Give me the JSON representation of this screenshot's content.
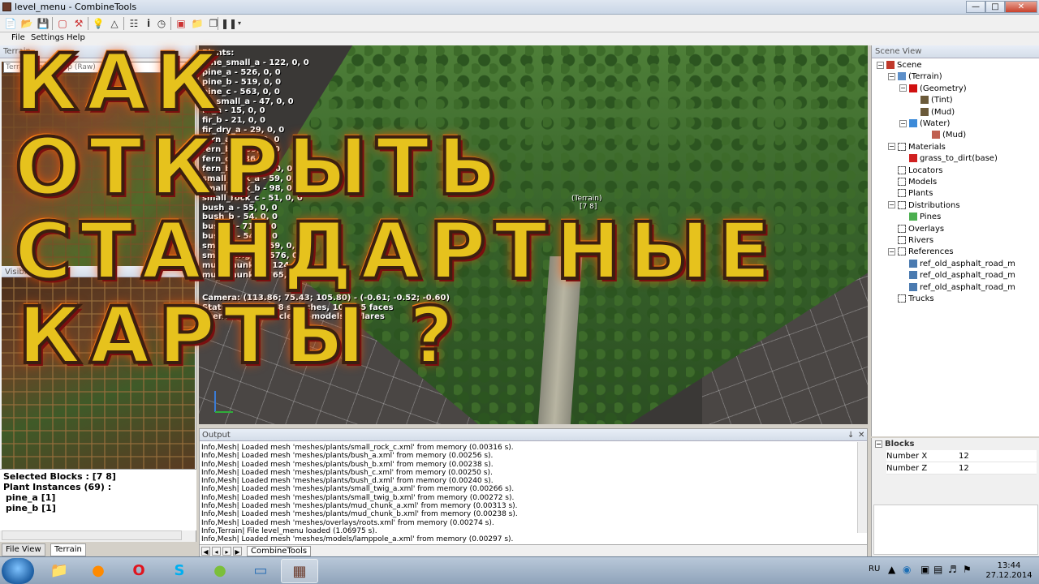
{
  "window": {
    "title": "level_menu - CombineTools",
    "minimize": "—",
    "maximize": "□",
    "close": "✕"
  },
  "menu": {
    "file": "File",
    "settings": "Settings",
    "help": "Help"
  },
  "left_panel": {
    "title": "Terrain",
    "terrain_select": "Terrain Game Map (Raw)",
    "visible_blocks_title": "Visible Blocks",
    "selected_blocks": "Selected Blocks : [7 8]",
    "plant_instances": "Plant Instances (69) :",
    "plant_list": [
      "pine_a [1]",
      "pine_b [1]"
    ],
    "tabs": [
      "File View",
      "Terrain"
    ]
  },
  "viewport": {
    "plants_header": "Plants:",
    "plants": [
      "pine_small_a - 122, 0, 0",
      "pine_a - 526, 0, 0",
      "pine_b - 519, 0, 0",
      "pine_c - 563, 0, 0",
      "fir_small_a - 47, 0, 0",
      "fir_a - 15, 0, 0",
      "fir_b - 21, 0, 0",
      "fir_dry_a - 29, 0, 0",
      "fern_a - 142, 0, 0",
      "fern_b - 169, 0, 0",
      "fern_c - 136, 0, 0",
      "fern_big_a - 63, 0, 0",
      "small_rock_a - 59, 0, 0",
      "small_rock_b - 98, 0, 0",
      "small_rock_c - 51, 0, 0",
      "bush_a - 55, 0, 0",
      "bush_b - 54, 0, 0",
      "bush_c - 71, 0, 0",
      "bush_d - 54, 0, 0",
      "small_twig_a - 59, 0, 0",
      "small_twig_b - 576, 0, 0",
      "mud_chunk_a - 124, 0, 0",
      "mud_chunk_b - 65, 0, 0"
    ],
    "camera": "Camera: (113.86; 75.43; 105.80) - (-0.61; -0.52; -0.60)",
    "stats": "Stats: 193 DIPs, 8 switches, 104525 faces",
    "scene": "Scene: 0(0) particles, 3 models, 3 flares",
    "terrain_label": "(Terrain)",
    "terrain_coord": "[7 8]"
  },
  "headline": {
    "line1": "КАК ОТКРЫТЬ",
    "line2": "СТАНДАРТНЫЕ",
    "line3": "КАРТЫ ?"
  },
  "output": {
    "title": "Output",
    "pin": "↓",
    "close": "✕",
    "lines": [
      "Info,Mesh| Loaded mesh 'meshes/plants/small_rock_c.xml' from memory (0.00316 s).",
      "Info,Mesh| Loaded mesh 'meshes/plants/bush_a.xml' from memory (0.00256 s).",
      "Info,Mesh| Loaded mesh 'meshes/plants/bush_b.xml' from memory (0.00238 s).",
      "Info,Mesh| Loaded mesh 'meshes/plants/bush_c.xml' from memory (0.00250 s).",
      "Info,Mesh| Loaded mesh 'meshes/plants/bush_d.xml' from memory (0.00240 s).",
      "Info,Mesh| Loaded mesh 'meshes/plants/small_twig_a.xml' from memory (0.00266 s).",
      "Info,Mesh| Loaded mesh 'meshes/plants/small_twig_b.xml' from memory (0.00272 s).",
      "Info,Mesh| Loaded mesh 'meshes/plants/mud_chunk_a.xml' from memory (0.00313 s).",
      "Info,Mesh| Loaded mesh 'meshes/plants/mud_chunk_b.xml' from memory (0.00238 s).",
      "Info,Mesh| Loaded mesh 'meshes/overlays/roots.xml' from memory (0.00274 s).",
      "Info,Terrain| File level_menu loaded (1.06975 s).",
      "Info,Mesh| Loaded mesh 'meshes/models/lamppole_a.xml' from memory (0.00297 s)."
    ],
    "tab": "CombineTools"
  },
  "scene_view": {
    "title": "Scene View",
    "nodes": [
      {
        "label": "Scene",
        "icon": "scene-icon",
        "color": "#c0392b"
      },
      {
        "label": "(Terrain)",
        "icon": "terrain-icon",
        "color": "#5d8fc9"
      },
      {
        "label": "(Geometry)",
        "icon": "geometry-icon",
        "color": "#d01010"
      },
      {
        "label": "(Tint)",
        "icon": "texture-icon",
        "color": "#6b5a3a"
      },
      {
        "label": "(Mud)",
        "icon": "texture-icon",
        "color": "#6b5a3a"
      },
      {
        "label": "(Water)",
        "icon": "water-drop-icon",
        "color": "#3c8ad8"
      },
      {
        "label": "(Mud)",
        "icon": "mud-drop-icon",
        "color": "#c06050"
      },
      {
        "label": "Materials",
        "icon": "folder-icon",
        "color": "#555555"
      },
      {
        "label": "grass_to_dirt(base)",
        "icon": "material-icon",
        "color": "#d02020"
      },
      {
        "label": "Locators",
        "icon": "folder-icon",
        "color": "#555555"
      },
      {
        "label": "Models",
        "icon": "folder-icon",
        "color": "#555555"
      },
      {
        "label": "Plants",
        "icon": "folder-icon",
        "color": "#555555"
      },
      {
        "label": "Distributions",
        "icon": "folder-icon",
        "color": "#555555"
      },
      {
        "label": "Pines",
        "icon": "plant-icon",
        "color": "#4caf50"
      },
      {
        "label": "Overlays",
        "icon": "folder-icon",
        "color": "#555555"
      },
      {
        "label": "Rivers",
        "icon": "folder-icon",
        "color": "#555555"
      },
      {
        "label": "References",
        "icon": "folder-icon",
        "color": "#555555"
      },
      {
        "label": "ref_old_asphalt_road_m",
        "icon": "reference-icon",
        "color": "#4a7ab0"
      },
      {
        "label": "ref_old_asphalt_road_m",
        "icon": "reference-icon",
        "color": "#4a7ab0"
      },
      {
        "label": "ref_old_asphalt_road_m",
        "icon": "reference-icon",
        "color": "#4a7ab0"
      },
      {
        "label": "Trucks",
        "icon": "folder-icon",
        "color": "#555555"
      }
    ]
  },
  "blocks": {
    "title": "Blocks",
    "rows": [
      {
        "name": "Number X",
        "value": "12"
      },
      {
        "name": "Number Z",
        "value": "12"
      }
    ]
  },
  "taskbar": {
    "lang": "RU",
    "time": "13:44",
    "date": "27.12.2014"
  }
}
